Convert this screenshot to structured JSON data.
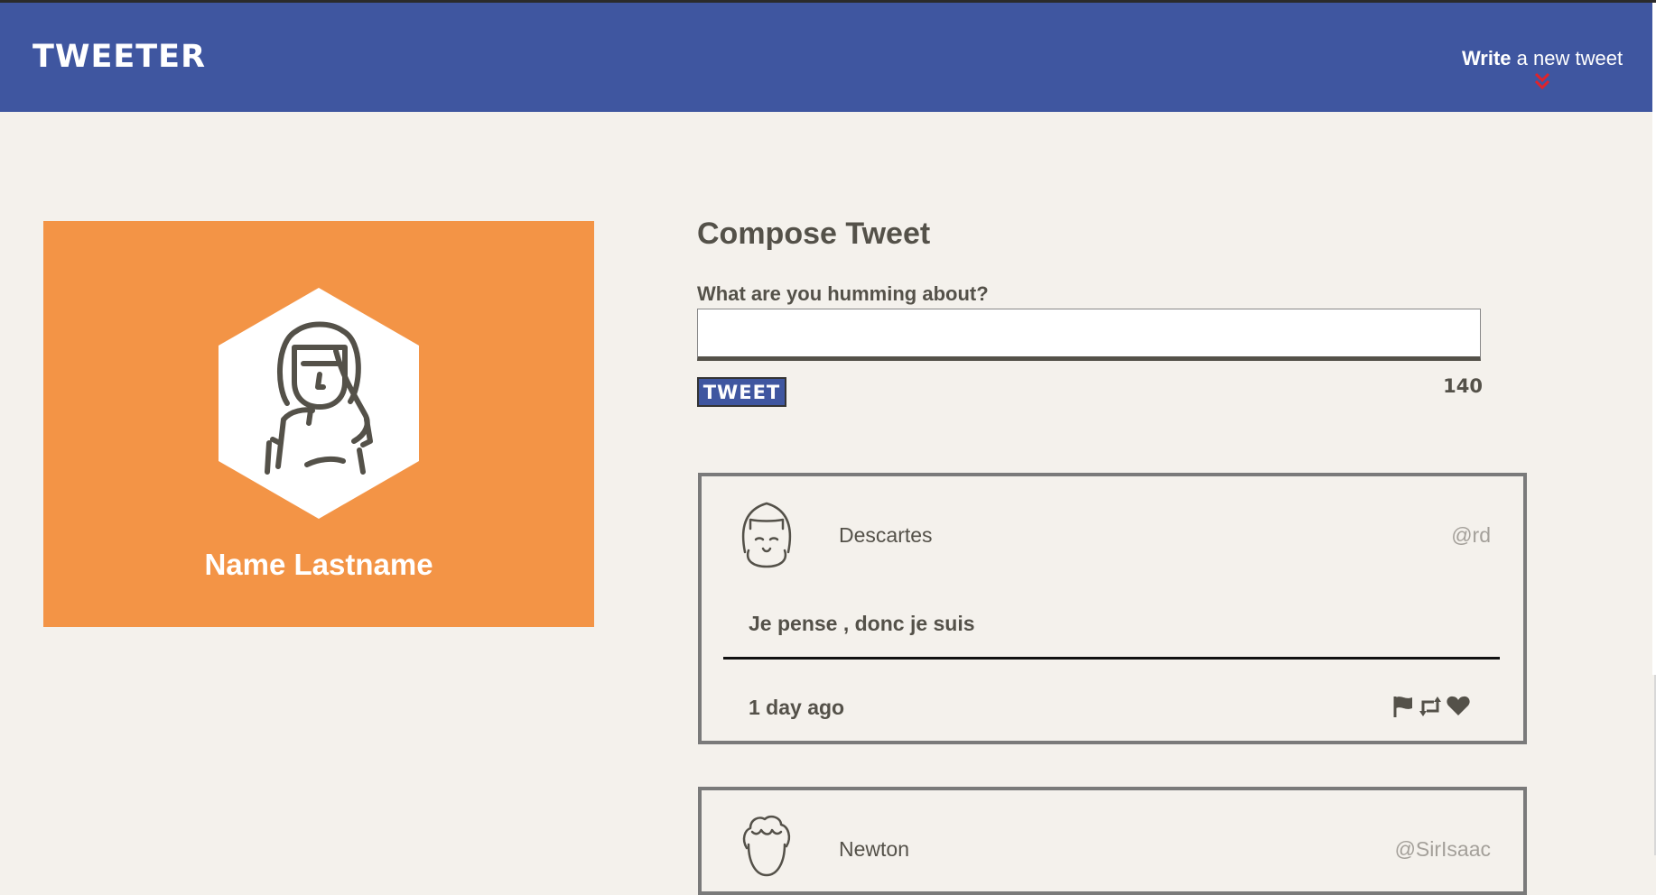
{
  "nav": {
    "logo": "TWEETER",
    "write_bold": "Write",
    "write_rest": " a new tweet"
  },
  "profile": {
    "name": "Name Lastname"
  },
  "compose": {
    "title": "Compose Tweet",
    "label": "What are you humming about?",
    "input_value": "",
    "button_label": "TWEET",
    "counter": "140"
  },
  "tweets": [
    {
      "name": "Descartes",
      "handle": "@rd",
      "content": "Je pense , donc je suis",
      "time": "1 day ago"
    },
    {
      "name": "Newton",
      "handle": "@SirIsaac"
    }
  ],
  "icons": {
    "chevron": "double-chevron-down-icon",
    "flag": "flag-icon",
    "retweet": "retweet-icon",
    "heart": "heart-icon"
  },
  "colors": {
    "nav_bg": "#3f56a0",
    "page_bg": "#f4f1ec",
    "profile_bg": "#f39446",
    "chevron": "#e0232b",
    "text": "#545149"
  }
}
